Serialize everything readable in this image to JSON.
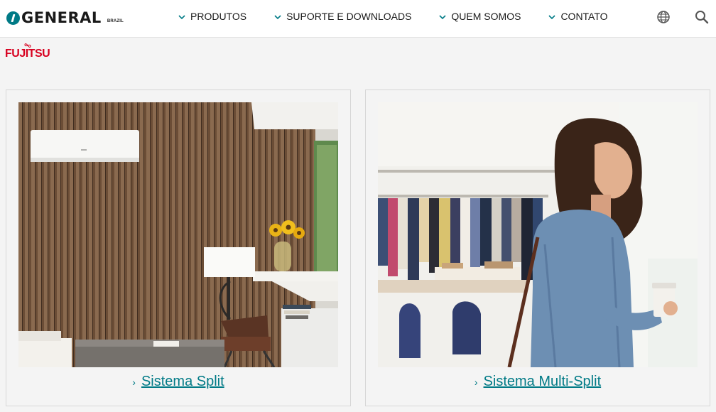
{
  "brand": {
    "logo_text": "GENERAL",
    "logo_country": "BRAZIL",
    "partner": "FUJITSU"
  },
  "nav": [
    {
      "label": "PRODUTOS"
    },
    {
      "label": "SUPORTE E DOWNLOADS"
    },
    {
      "label": "QUEM SOMOS"
    },
    {
      "label": "CONTATO"
    }
  ],
  "header_icons": {
    "language": "globe-icon",
    "search": "search-icon"
  },
  "cards": [
    {
      "link": "Sistema Split",
      "image": "living-room-with-wall-mounted-ac"
    },
    {
      "link": "Sistema Multi-Split",
      "image": "woman-in-clothing-store"
    }
  ],
  "colors": {
    "accent": "#007a86",
    "fujitsu_red": "#d7001f",
    "background": "#f4f4f4"
  }
}
